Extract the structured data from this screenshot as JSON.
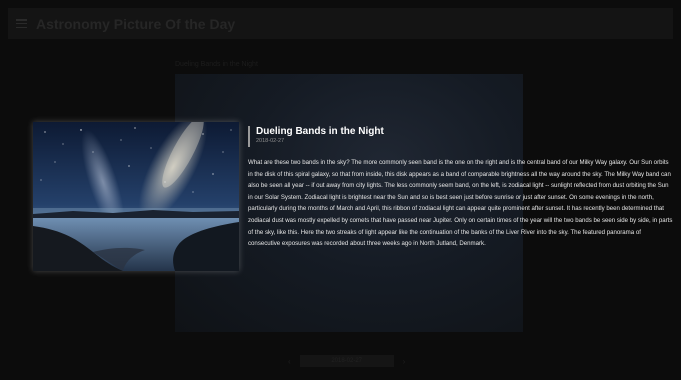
{
  "app": {
    "title": "Astronomy Picture Of the Day"
  },
  "background": {
    "caption": "Dueling Bands in the Night"
  },
  "pager": {
    "prev": "‹",
    "next": "›",
    "date_label": "2018-02-27"
  },
  "featured": {
    "title": "Dueling Bands in the Night",
    "date": "2018-02-27",
    "explanation": "What are these two bands in the sky? The more commonly seen band is the one on the right and is the central band of our Milky Way galaxy. Our Sun orbits in the disk of this spiral galaxy, so that from inside, this disk appears as a band of comparable brightness all the way around the sky. The Milky Way band can also be seen all year -- if out away from city lights. The less commonly seem band, on the left, is zodiacal light -- sunlight reflected from dust orbiting the Sun in our Solar System. Zodiacal light is brightest near the Sun and so is best seen just before sunrise or just after sunset. On some evenings in the north, particularly during the months of March and April, this ribbon of zodiacal light can appear quite prominent after sunset. It has recently been determined that zodiacal dust was mostly expelled by comets that have passed near Jupiter. Only on certain times of the year will the two bands be seen side by side, in parts of the sky, like this. Here the two streaks of light appear like the continuation of the banks of the Liver River into the sky. The featured panorama of consecutive exposures was recorded about three weeks ago in North Jutland, Denmark."
  },
  "icons": {
    "menu": "menu-icon",
    "prev": "chevron-left-icon",
    "next": "chevron-right-icon"
  }
}
